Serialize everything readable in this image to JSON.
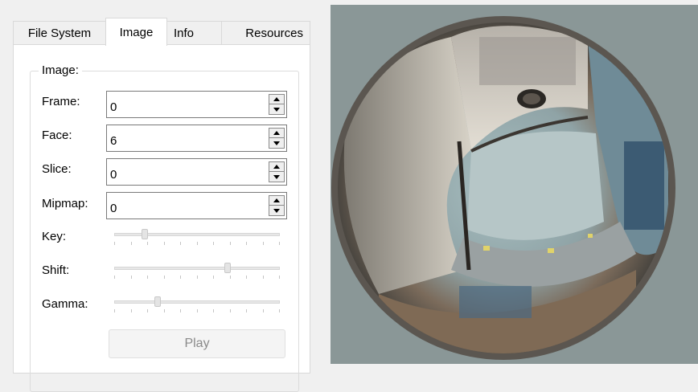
{
  "tabs": [
    {
      "label": "File System",
      "active": false
    },
    {
      "label": "Image",
      "active": true
    },
    {
      "label": "Info",
      "active": false
    },
    {
      "label": "Resources",
      "active": false
    }
  ],
  "image_group": {
    "title": "Image:",
    "frame": {
      "label": "Frame:",
      "value": "0"
    },
    "face": {
      "label": "Face:",
      "value": "6"
    },
    "slice": {
      "label": "Slice:",
      "value": "0"
    },
    "mipmap": {
      "label": "Mipmap:",
      "value": "0"
    },
    "key": {
      "label": "Key:",
      "level": 0.17
    },
    "shift": {
      "label": "Shift:",
      "level": 0.69
    },
    "gamma": {
      "label": "Gamma:",
      "level": 0.25
    },
    "play_label": "Play"
  },
  "colors": {
    "preview_background": "#8a9797",
    "sphere_rim": "#5b5650"
  },
  "icons": [
    "spin-up-arrow-icon",
    "spin-down-arrow-icon"
  ]
}
